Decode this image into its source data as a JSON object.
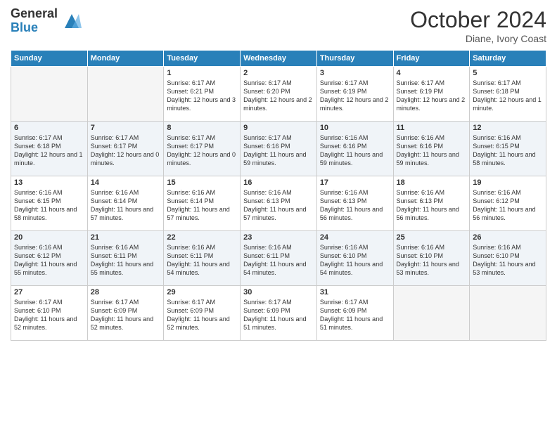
{
  "header": {
    "logo_general": "General",
    "logo_blue": "Blue",
    "month_title": "October 2024",
    "location": "Diane, Ivory Coast"
  },
  "weekdays": [
    "Sunday",
    "Monday",
    "Tuesday",
    "Wednesday",
    "Thursday",
    "Friday",
    "Saturday"
  ],
  "weeks": [
    [
      {
        "day": "",
        "info": ""
      },
      {
        "day": "",
        "info": ""
      },
      {
        "day": "1",
        "info": "Sunrise: 6:17 AM\nSunset: 6:21 PM\nDaylight: 12 hours and 3 minutes."
      },
      {
        "day": "2",
        "info": "Sunrise: 6:17 AM\nSunset: 6:20 PM\nDaylight: 12 hours and 2 minutes."
      },
      {
        "day": "3",
        "info": "Sunrise: 6:17 AM\nSunset: 6:19 PM\nDaylight: 12 hours and 2 minutes."
      },
      {
        "day": "4",
        "info": "Sunrise: 6:17 AM\nSunset: 6:19 PM\nDaylight: 12 hours and 2 minutes."
      },
      {
        "day": "5",
        "info": "Sunrise: 6:17 AM\nSunset: 6:18 PM\nDaylight: 12 hours and 1 minute."
      }
    ],
    [
      {
        "day": "6",
        "info": "Sunrise: 6:17 AM\nSunset: 6:18 PM\nDaylight: 12 hours and 1 minute."
      },
      {
        "day": "7",
        "info": "Sunrise: 6:17 AM\nSunset: 6:17 PM\nDaylight: 12 hours and 0 minutes."
      },
      {
        "day": "8",
        "info": "Sunrise: 6:17 AM\nSunset: 6:17 PM\nDaylight: 12 hours and 0 minutes."
      },
      {
        "day": "9",
        "info": "Sunrise: 6:17 AM\nSunset: 6:16 PM\nDaylight: 11 hours and 59 minutes."
      },
      {
        "day": "10",
        "info": "Sunrise: 6:16 AM\nSunset: 6:16 PM\nDaylight: 11 hours and 59 minutes."
      },
      {
        "day": "11",
        "info": "Sunrise: 6:16 AM\nSunset: 6:16 PM\nDaylight: 11 hours and 59 minutes."
      },
      {
        "day": "12",
        "info": "Sunrise: 6:16 AM\nSunset: 6:15 PM\nDaylight: 11 hours and 58 minutes."
      }
    ],
    [
      {
        "day": "13",
        "info": "Sunrise: 6:16 AM\nSunset: 6:15 PM\nDaylight: 11 hours and 58 minutes."
      },
      {
        "day": "14",
        "info": "Sunrise: 6:16 AM\nSunset: 6:14 PM\nDaylight: 11 hours and 57 minutes."
      },
      {
        "day": "15",
        "info": "Sunrise: 6:16 AM\nSunset: 6:14 PM\nDaylight: 11 hours and 57 minutes."
      },
      {
        "day": "16",
        "info": "Sunrise: 6:16 AM\nSunset: 6:13 PM\nDaylight: 11 hours and 57 minutes."
      },
      {
        "day": "17",
        "info": "Sunrise: 6:16 AM\nSunset: 6:13 PM\nDaylight: 11 hours and 56 minutes."
      },
      {
        "day": "18",
        "info": "Sunrise: 6:16 AM\nSunset: 6:13 PM\nDaylight: 11 hours and 56 minutes."
      },
      {
        "day": "19",
        "info": "Sunrise: 6:16 AM\nSunset: 6:12 PM\nDaylight: 11 hours and 56 minutes."
      }
    ],
    [
      {
        "day": "20",
        "info": "Sunrise: 6:16 AM\nSunset: 6:12 PM\nDaylight: 11 hours and 55 minutes."
      },
      {
        "day": "21",
        "info": "Sunrise: 6:16 AM\nSunset: 6:11 PM\nDaylight: 11 hours and 55 minutes."
      },
      {
        "day": "22",
        "info": "Sunrise: 6:16 AM\nSunset: 6:11 PM\nDaylight: 11 hours and 54 minutes."
      },
      {
        "day": "23",
        "info": "Sunrise: 6:16 AM\nSunset: 6:11 PM\nDaylight: 11 hours and 54 minutes."
      },
      {
        "day": "24",
        "info": "Sunrise: 6:16 AM\nSunset: 6:10 PM\nDaylight: 11 hours and 54 minutes."
      },
      {
        "day": "25",
        "info": "Sunrise: 6:16 AM\nSunset: 6:10 PM\nDaylight: 11 hours and 53 minutes."
      },
      {
        "day": "26",
        "info": "Sunrise: 6:16 AM\nSunset: 6:10 PM\nDaylight: 11 hours and 53 minutes."
      }
    ],
    [
      {
        "day": "27",
        "info": "Sunrise: 6:17 AM\nSunset: 6:10 PM\nDaylight: 11 hours and 52 minutes."
      },
      {
        "day": "28",
        "info": "Sunrise: 6:17 AM\nSunset: 6:09 PM\nDaylight: 11 hours and 52 minutes."
      },
      {
        "day": "29",
        "info": "Sunrise: 6:17 AM\nSunset: 6:09 PM\nDaylight: 11 hours and 52 minutes."
      },
      {
        "day": "30",
        "info": "Sunrise: 6:17 AM\nSunset: 6:09 PM\nDaylight: 11 hours and 51 minutes."
      },
      {
        "day": "31",
        "info": "Sunrise: 6:17 AM\nSunset: 6:09 PM\nDaylight: 11 hours and 51 minutes."
      },
      {
        "day": "",
        "info": ""
      },
      {
        "day": "",
        "info": ""
      }
    ]
  ]
}
